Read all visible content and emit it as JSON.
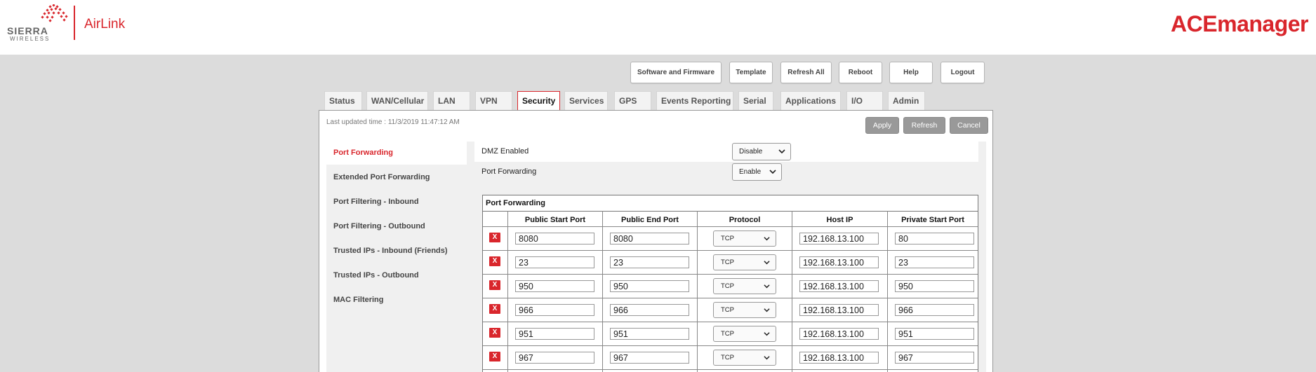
{
  "brand": {
    "company_name": "SIERRA",
    "company_sub": "WIRELESS",
    "product_name": "AirLink",
    "app_name": "ACEmanager",
    "accent_color": "#d9262c"
  },
  "toolbar": {
    "buttons": [
      "Software and Firmware",
      "Template",
      "Refresh All",
      "Reboot",
      "Help",
      "Logout"
    ]
  },
  "tabs": [
    "Status",
    "WAN/Cellular",
    "LAN",
    "VPN",
    "Security",
    "Services",
    "GPS",
    "Events Reporting",
    "Serial",
    "Applications",
    "I/O",
    "Admin"
  ],
  "active_tab": "Security",
  "panel": {
    "last_updated": "Last updated time : 11/3/2019 11:47:12 AM",
    "actions": [
      "Apply",
      "Refresh",
      "Cancel"
    ]
  },
  "sidebar": {
    "items": [
      "Port Forwarding",
      "Extended Port Forwarding",
      "Port Filtering - Inbound",
      "Port Filtering - Outbound",
      "Trusted IPs - Inbound (Friends)",
      "Trusted IPs - Outbound",
      "MAC Filtering"
    ],
    "active": "Port Forwarding"
  },
  "settings": {
    "dmz": {
      "label": "DMZ Enabled",
      "value": "Disable"
    },
    "port_forwarding": {
      "label": "Port Forwarding",
      "value": "Enable"
    }
  },
  "table": {
    "caption": "Port Forwarding",
    "delete_label": "X",
    "columns": [
      "Public Start Port",
      "Public End Port",
      "Protocol",
      "Host IP",
      "Private Start Port"
    ],
    "rows": [
      {
        "public_start": "8080",
        "public_end": "8080",
        "protocol": "TCP",
        "host_ip": "192.168.13.100",
        "private_start": "80"
      },
      {
        "public_start": "23",
        "public_end": "23",
        "protocol": "TCP",
        "host_ip": "192.168.13.100",
        "private_start": "23"
      },
      {
        "public_start": "950",
        "public_end": "950",
        "protocol": "TCP",
        "host_ip": "192.168.13.100",
        "private_start": "950"
      },
      {
        "public_start": "966",
        "public_end": "966",
        "protocol": "TCP",
        "host_ip": "192.168.13.100",
        "private_start": "966"
      },
      {
        "public_start": "951",
        "public_end": "951",
        "protocol": "TCP",
        "host_ip": "192.168.13.100",
        "private_start": "951"
      },
      {
        "public_start": "967",
        "public_end": "967",
        "protocol": "TCP",
        "host_ip": "192.168.13.100",
        "private_start": "967"
      }
    ]
  }
}
